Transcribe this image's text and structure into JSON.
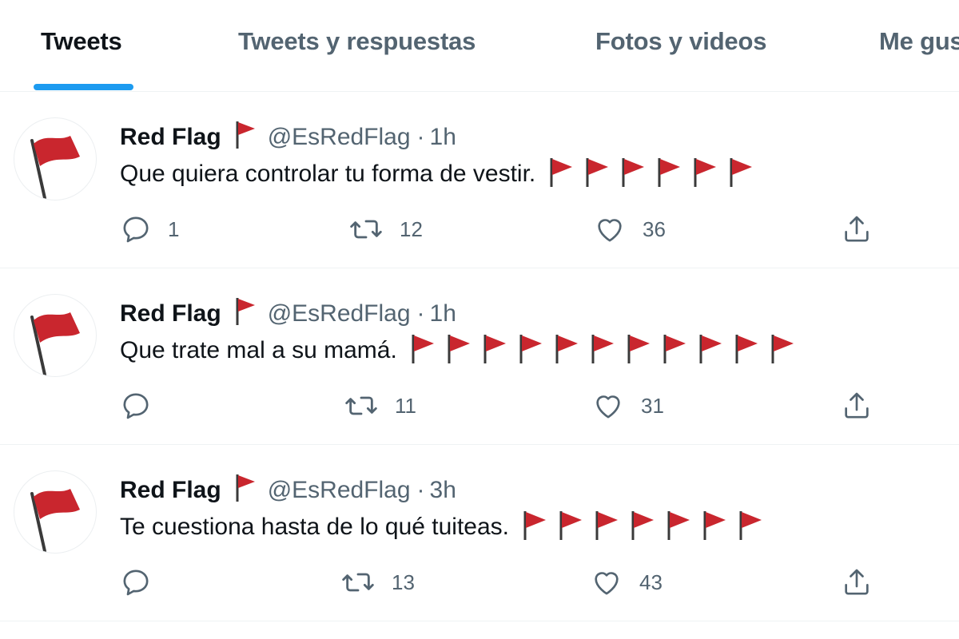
{
  "tabs": [
    {
      "label": "Tweets",
      "active": true
    },
    {
      "label": "Tweets y respuestas",
      "active": false
    },
    {
      "label": "Fotos y videos",
      "active": false
    },
    {
      "label": "Me gus",
      "active": false
    }
  ],
  "colors": {
    "accent": "#1d9bf0",
    "flag_red": "#c9262e",
    "muted": "#536471"
  },
  "tweets": [
    {
      "name": "Red Flag",
      "handle": "@EsRedFlag",
      "sep": "·",
      "time": "1h",
      "text": "Que quiera controlar tu forma de vestir.",
      "flag_count": 6,
      "replies": "1",
      "retweets": "12",
      "likes": "36"
    },
    {
      "name": "Red Flag",
      "handle": "@EsRedFlag",
      "sep": "·",
      "time": "1h",
      "text": "Que trate mal a su mamá.",
      "flag_count": 11,
      "replies": "",
      "retweets": "11",
      "likes": "31"
    },
    {
      "name": "Red Flag",
      "handle": "@EsRedFlag",
      "sep": "·",
      "time": "3h",
      "text": "Te cuestiona hasta de lo qué tuiteas.",
      "flag_count": 7,
      "replies": "",
      "retweets": "13",
      "likes": "43"
    }
  ],
  "icons": {
    "reply": "reply-bubble-icon",
    "retweet": "retweet-icon",
    "like": "heart-icon",
    "share": "share-upload-icon",
    "avatar": "red-flag-icon"
  }
}
